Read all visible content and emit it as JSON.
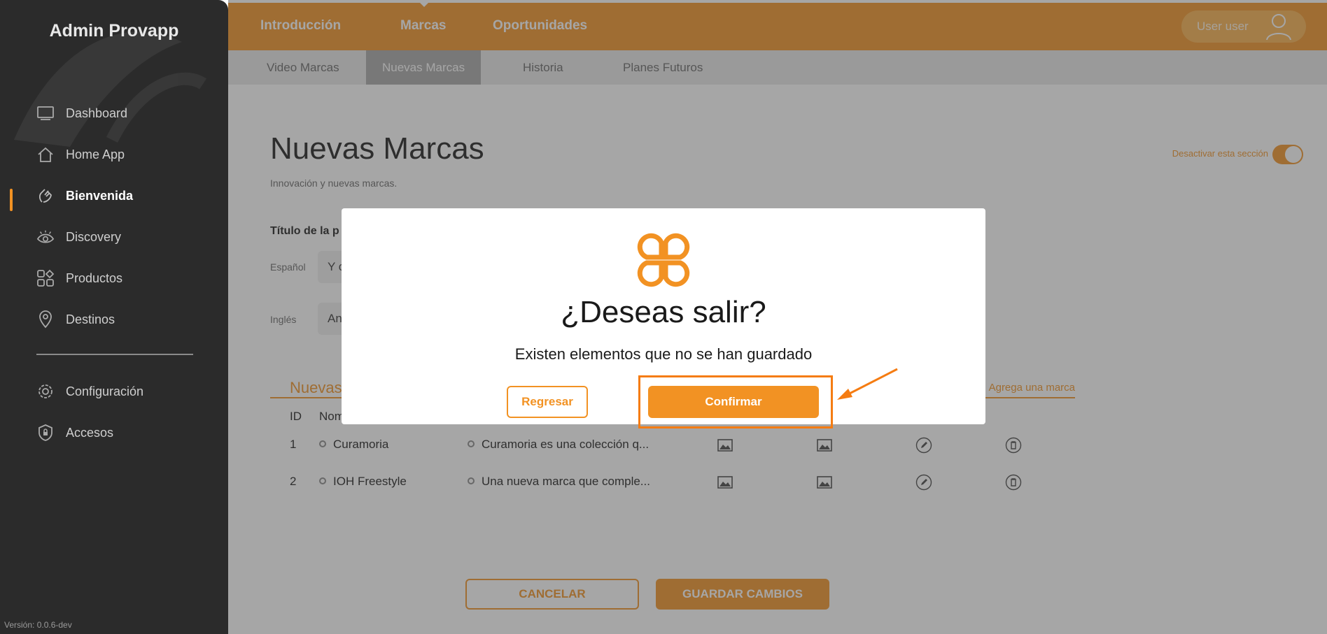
{
  "sidebar": {
    "title": "Admin Provapp",
    "items": [
      {
        "label": "Dashboard",
        "icon": "monitor-icon"
      },
      {
        "label": "Home App",
        "icon": "home-icon"
      },
      {
        "label": "Bienvenida",
        "icon": "wave-hand-icon",
        "active": true
      },
      {
        "label": "Discovery",
        "icon": "eye-icon"
      },
      {
        "label": "Productos",
        "icon": "grid-shapes-icon"
      },
      {
        "label": "Destinos",
        "icon": "map-pin-icon"
      },
      {
        "label": "Configuración",
        "icon": "gear-icon"
      },
      {
        "label": "Accesos",
        "icon": "shield-lock-icon"
      }
    ],
    "version": "Versión: 0.0.6-dev"
  },
  "topbar": {
    "tabs": [
      {
        "label": "Introducción"
      },
      {
        "label": "Marcas",
        "active": true
      },
      {
        "label": "Oportunidades"
      }
    ],
    "user_label": "User user"
  },
  "subtabs": [
    {
      "label": "Video Marcas"
    },
    {
      "label": "Nuevas Marcas",
      "active": true
    },
    {
      "label": "Historia"
    },
    {
      "label": "Planes Futuros"
    }
  ],
  "page": {
    "title": "Nuevas Marcas",
    "subtitle": "Innovación y nuevas marcas.",
    "toggle_label": "Desactivar esta sección",
    "section_title": "Título de la p",
    "fields": [
      {
        "label": "Español",
        "value": "Y c"
      },
      {
        "label": "Inglés",
        "value": "An"
      }
    ],
    "list_title": "Nuevas",
    "add_label": "Agrega una marca",
    "columns": [
      "ID",
      "Nom"
    ],
    "rows": [
      {
        "id": "1",
        "name": "Curamoria",
        "description": "Curamoria es una colección q..."
      },
      {
        "id": "2",
        "name": "IOH Freestyle",
        "description": "Una nueva marca que comple..."
      }
    ],
    "cancel_label": "CANCELAR",
    "save_label": "GUARDAR CAMBIOS"
  },
  "modal": {
    "title": "¿Deseas salir?",
    "message": "Existen elementos que no se han guardado",
    "back_label": "Regresar",
    "confirm_label": "Confirmar"
  },
  "colors": {
    "accent": "#f29223",
    "sidebar": "#2b2b2b",
    "highlight": "#f57c12"
  }
}
